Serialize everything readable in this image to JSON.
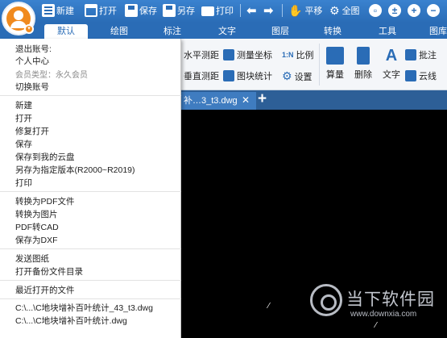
{
  "toolbar": {
    "new": "新建",
    "open": "打开",
    "save": "保存",
    "save_as": "另存",
    "print": "打印",
    "pan": "平移",
    "full_view": "全图"
  },
  "tabs": [
    "默认",
    "绘图",
    "标注",
    "文字",
    "图层",
    "转换",
    "工具",
    "图库"
  ],
  "ribbon": {
    "horizontal_measure": "水平测距",
    "measure_coords": "测量坐标",
    "scale": "比例",
    "vertical_measure": "垂直测距",
    "block_stats": "图块统计",
    "settings": "设置",
    "quantity": "算量",
    "delete": "删除",
    "text": "文字",
    "annotate": "批注",
    "cloud_line": "云线",
    "scale_icon_label": "1:N"
  },
  "document": {
    "tab_title": "补…3_t3.dwg"
  },
  "menu": {
    "account_group": [
      {
        "label": "退出账号:",
        "muted": false
      },
      {
        "label": "个人中心",
        "muted": false
      },
      {
        "label": "会员类型：永久会员",
        "muted": true
      },
      {
        "label": "切换账号",
        "muted": false
      }
    ],
    "file_group": [
      "新建",
      "打开",
      "修复打开",
      "保存",
      "保存到我的云盘",
      "另存为指定版本(R2000~R2019)",
      "打印"
    ],
    "convert_group": [
      "转换为PDF文件",
      "转换为图片",
      "PDF转CAD",
      "保存为DXF"
    ],
    "send_group": [
      "发送图纸",
      "打开备份文件目录"
    ],
    "recent_header": "最近打开的文件",
    "recent_files": [
      "C:\\...\\C地块增补百叶统计_43_t3.dwg",
      "C:\\...\\C地块增补百叶统计.dwg"
    ]
  },
  "watermark": {
    "title": "当下软件园",
    "url": "www.downxia.com"
  },
  "colors": {
    "primary": "#2a6cb6",
    "canvas": "#000000",
    "logo": "#f08a1e"
  }
}
